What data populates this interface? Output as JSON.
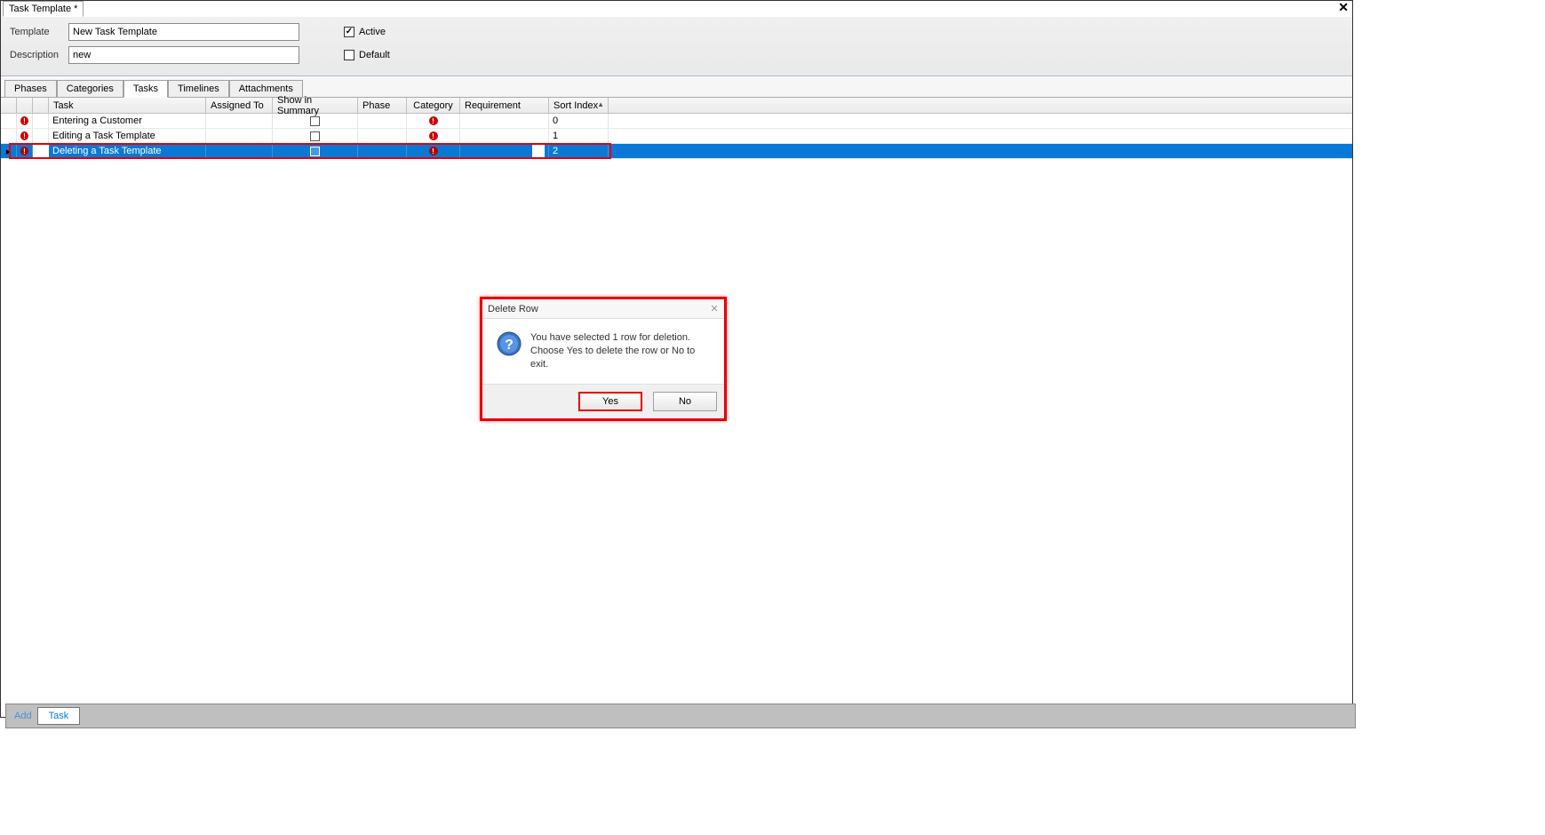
{
  "window": {
    "tab_title": "Task Template *"
  },
  "form": {
    "template_label": "Template",
    "template_value": "New Task Template",
    "description_label": "Description",
    "description_value": "new",
    "active_label": "Active",
    "default_label": "Default"
  },
  "tabs": [
    {
      "label": "Phases"
    },
    {
      "label": "Categories"
    },
    {
      "label": "Tasks"
    },
    {
      "label": "Timelines"
    },
    {
      "label": "Attachments"
    }
  ],
  "grid": {
    "headers": {
      "task": "Task",
      "assigned_to": "Assigned To",
      "show_in_summary": "Show in Summary",
      "phase": "Phase",
      "category": "Category",
      "requirement": "Requirement",
      "sort_index": "Sort Index"
    },
    "rows": [
      {
        "task": "Entering a Customer",
        "sort_index": "0"
      },
      {
        "task": "Editing a Task Template",
        "sort_index": "1"
      },
      {
        "task": "Deleting a Task Template",
        "sort_index": "2"
      }
    ]
  },
  "dialog": {
    "title": "Delete Row",
    "line1": "You have selected 1 row for deletion.",
    "line2": "Choose Yes to delete the row or No to exit.",
    "yes": "Yes",
    "no": "No"
  },
  "statusbar": {
    "add": "Add",
    "task": "Task"
  }
}
